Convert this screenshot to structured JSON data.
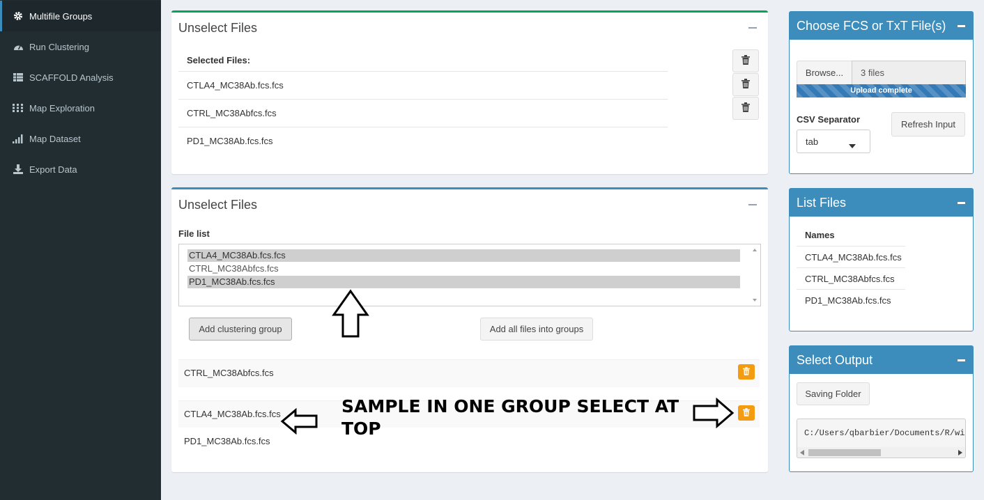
{
  "sidebar": {
    "items": [
      {
        "label": "Multifile Groups",
        "icon": "gear-icon",
        "active": true
      },
      {
        "label": "Run Clustering",
        "icon": "dashboard-icon",
        "active": false
      },
      {
        "label": "SCAFFOLD Analysis",
        "icon": "table-icon",
        "active": false
      },
      {
        "label": "Map Exploration",
        "icon": "grid-dots-icon",
        "active": false
      },
      {
        "label": "Map Dataset",
        "icon": "signal-bars-icon",
        "active": false
      },
      {
        "label": "Export Data",
        "icon": "download-icon",
        "active": false
      }
    ]
  },
  "box1": {
    "title": "Unselect Files",
    "header": "Selected Files:",
    "files": [
      "CTLA4_MC38Ab.fcs.fcs",
      "CTRL_MC38Abfcs.fcs",
      "PD1_MC38Ab.fcs.fcs"
    ]
  },
  "box2": {
    "title": "Unselect Files",
    "file_list_label": "File list",
    "options": [
      {
        "label": "CTLA4_MC38Ab.fcs.fcs",
        "selected": true
      },
      {
        "label": "CTRL_MC38Abfcs.fcs",
        "selected": false
      },
      {
        "label": "PD1_MC38Ab.fcs.fcs",
        "selected": true
      }
    ],
    "add_group_label": "Add clustering group",
    "add_all_label": "Add all files into groups",
    "groups": [
      {
        "files": [
          "CTRL_MC38Abfcs.fcs"
        ]
      },
      {
        "files": [
          "CTLA4_MC38Ab.fcs.fcs",
          "PD1_MC38Ab.fcs.fcs"
        ]
      }
    ],
    "annotation": "SAMPLE IN ONE GROUP SELECT AT TOP"
  },
  "choose_box": {
    "title": "Choose FCS or TxT File(s)",
    "browse_label": "Browse...",
    "file_count": "3 files",
    "upload_status": "Upload complete",
    "upload_progress": 1.0,
    "csv_label": "CSV Separator",
    "csv_value": "tab",
    "refresh_label": "Refresh Input"
  },
  "list_box": {
    "title": "List Files",
    "header": "Names",
    "files": [
      "CTLA4_MC38Ab.fcs.fcs",
      "CTRL_MC38Abfcs.fcs",
      "PD1_MC38Ab.fcs.fcs"
    ]
  },
  "output_box": {
    "title": "Select Output",
    "saving_label": "Saving Folder",
    "path": "C:/Users/qbarbier/Documents/R/win"
  },
  "colors": {
    "sidebar_bg": "#222d32",
    "primary": "#3c8dbc",
    "success": "#00a65a",
    "warning": "#f39c12"
  }
}
